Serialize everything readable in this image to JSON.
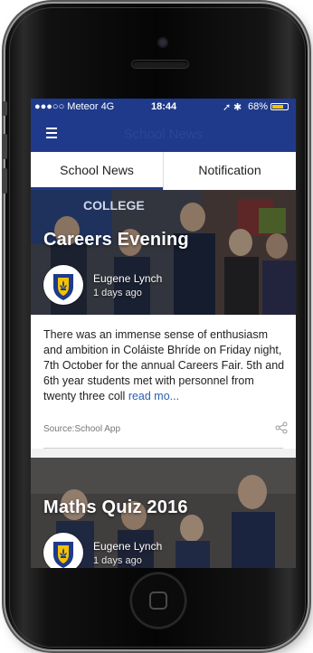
{
  "status_bar": {
    "carrier": "●●●○○ Meteor  4G",
    "time": "18:44",
    "battery": "68%"
  },
  "nav": {
    "title": "School News",
    "menu_icon": "hamburger-menu-icon"
  },
  "tabs": [
    {
      "label": "School News",
      "active": true
    },
    {
      "label": "Notification",
      "active": false
    }
  ],
  "colors": {
    "primary": "#1f3a8a",
    "link": "#2a5fb0",
    "crest": "#f2c200"
  },
  "cards": [
    {
      "title": "Careers Evening",
      "author": "Eugene Lynch",
      "time": "1 days ago",
      "body": "There was an immense sense of enthusiasm and ambition in Coláiste Bhríde on Friday night, 7th October for the annual Careers Fair.  5th and 6th year students met with personnel from  twenty three coll",
      "read_more": "read mo...",
      "source": "Source:School App",
      "banner_text": "COLLEGE"
    },
    {
      "title": "Maths Quiz 2016",
      "author": "Eugene Lynch",
      "time": "1 days ago"
    }
  ]
}
